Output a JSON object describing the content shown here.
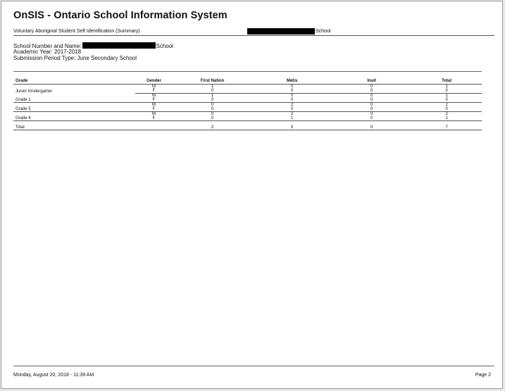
{
  "header": {
    "title": "OnSIS - Ontario School Information System",
    "report_name": "Voluntary Aboriginal Student Self Identification (Summary)",
    "school_suffix": "School"
  },
  "info": {
    "school_label": "School Number and Name:",
    "school_suffix": "School",
    "academic_year": "Academic Year:  2017-2018",
    "submission_period": "Submission Period Type: June Secondary School"
  },
  "table": {
    "headers": [
      "Grade",
      "Gender",
      "First Nation",
      "Métis",
      "Inuit",
      "Total"
    ],
    "rows": [
      {
        "grade": "Junior Kindergarten",
        "values": [
          [
            "M",
            "1",
            "0",
            "0",
            "1"
          ],
          [
            "F",
            "0",
            "0",
            "0",
            "0"
          ]
        ]
      },
      {
        "grade": "Grade 1",
        "values": [
          [
            "M",
            "1",
            "0",
            "0",
            "1"
          ],
          [
            "F",
            "0",
            "0",
            "0",
            "0"
          ]
        ]
      },
      {
        "grade": "Grade 5",
        "values": [
          [
            "M",
            "0",
            "2",
            "0",
            "2"
          ],
          [
            "F",
            "0",
            "0",
            "0",
            "0"
          ]
        ]
      },
      {
        "grade": "Grade 6",
        "values": [
          [
            "M",
            "0",
            "2",
            "0",
            "2"
          ],
          [
            "F",
            "0",
            "1",
            "0",
            "1"
          ]
        ]
      }
    ],
    "total": {
      "label": "Total",
      "first_nation": "2",
      "metis": "5",
      "inuit": "0",
      "total": "7"
    }
  },
  "footer": {
    "timestamp": "Monday, August 20, 2018 - 11:39 AM",
    "page": "Page 2"
  },
  "colors": {
    "redaction": "#000000",
    "rule": "#555555",
    "page": "#ffffff"
  }
}
